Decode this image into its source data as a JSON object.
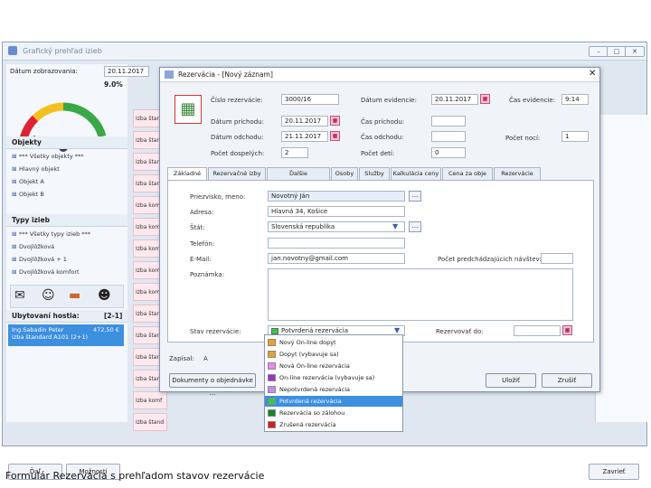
{
  "bg_window": {
    "title": "Grafický prehľad izieb",
    "date_label": "Dátum zobrazovania:",
    "date_value": "20.11.2017",
    "gauge_percent": "9.0%",
    "gauge_ticks": [
      "0",
      "10",
      "20",
      "40",
      "60",
      "80",
      "100"
    ],
    "objects_header": "Objekty",
    "objects": [
      "*** Všetky objekty ***",
      "Hlavný objekt",
      "Objekt A",
      "Objekt B"
    ],
    "room_types_header": "Typy izieb",
    "room_types": [
      "*** Všetky typy izieb ***",
      "Dvojlôžková",
      "Dvojlôžková + 1",
      "Dvojlôžková komfort"
    ],
    "guests_header": "Ubytovaní hostia:",
    "guests_count": "[2-1]",
    "guest_name": "Ing.Sabadin Peter",
    "guest_amount": "472,50 €",
    "guest_room": "izba štandard A101 (2+1)",
    "room_tabs": [
      "Izba štand",
      "Izba štand",
      "Izba štand",
      "Izba štand",
      "Izba komf",
      "Izba komf",
      "Izba komf",
      "Izba komf",
      "Izba komf",
      "Izba štand",
      "Izba štand",
      "Izba štand",
      "Izba štand",
      "Izba komf",
      "Izba štand"
    ],
    "close_button": "Zavrieť",
    "left_buttons": [
      "Ďaľ",
      "Možnosti"
    ]
  },
  "dialog": {
    "title": "Rezervácia - [Nový záznam]",
    "fields": {
      "reservation_no_label": "Číslo rezervácie:",
      "reservation_no": "3000/16",
      "date_evidence_label": "Dátum evidencie:",
      "date_evidence": "20.11.2017",
      "time_evidence_label": "Čas evidencie:",
      "time_evidence": "9:14",
      "arrival_label": "Dátum príchodu:",
      "arrival": "20.11.2017",
      "arrival_time_label": "Čas príchodu:",
      "departure_label": "Dátum odchodu:",
      "departure": "21.11.2017",
      "departure_time_label": "Čas odchodu:",
      "nights_label": "Počet nocí:",
      "nights": "1",
      "adults_label": "Počet dospelých:",
      "adults": "2",
      "children_label": "Počet detí:",
      "children": "0"
    },
    "tabs": [
      "Základné",
      "Rezervačné izby",
      "Ďalšie údaje/poznámky",
      "Osoby",
      "Služby",
      "Kalkulácia ceny",
      "Cena za obje",
      "Rezervácie"
    ],
    "form": {
      "name_label": "Priezvisko, meno:",
      "name": "Novotný Ján",
      "address_label": "Adresa:",
      "address": "Hlavná 34, Košice",
      "country_label": "Štát:",
      "country": "Slovenská republika",
      "phone_label": "Telefón:",
      "email_label": "E-Mail:",
      "email": "jan.novotny@gmail.com",
      "previous_label": "Počet predchádzajúcich návštev:",
      "note_label": "Poznámka:",
      "status_label": "Stav rezervácie:",
      "status_value": "Potvrdená rezervácia",
      "reserve_until_label": "Rezervovať do:"
    },
    "recorded_label": "Zapísal:",
    "recorded_value": "A",
    "docs_button": "Dokumenty o objednávke ...",
    "save_button": "Uložiť",
    "cancel_button": "Zrušiť"
  },
  "status_options": [
    {
      "label": "Nový On-line dopyt",
      "color": "#f0a020"
    },
    {
      "label": "Dopyt (vybavuje sa)",
      "color": "#e8a030"
    },
    {
      "label": "Nová On-line rezervácia",
      "color": "#ee88ee"
    },
    {
      "label": "On-line rezervácia (vybavuje sa)",
      "color": "#9933cc"
    },
    {
      "label": "Nepotvrdená rezervácia",
      "color": "#cc88ee"
    },
    {
      "label": "Potvrdená rezervácia",
      "color": "#33cc44"
    },
    {
      "label": "Rezervácia so zálohou",
      "color": "#118822"
    },
    {
      "label": "Zrušená rezervácia",
      "color": "#cc2222"
    }
  ],
  "selected_status_index": 5,
  "caption": "Formulár Rezervácia s prehľadom stavov rezervácie"
}
